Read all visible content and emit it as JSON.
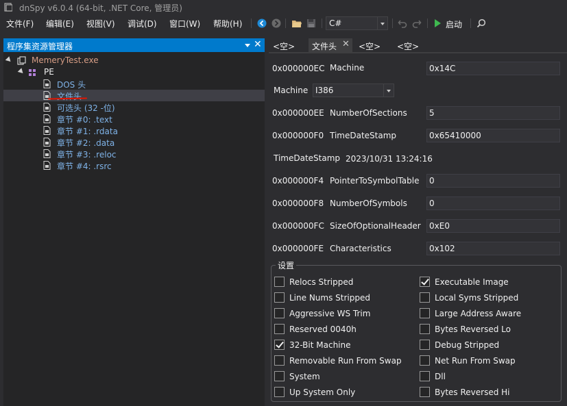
{
  "window": {
    "title": "dnSpy v6.0.4 (64-bit, .NET Core, 管理员)"
  },
  "menu": [
    "文件(F)",
    "编辑(E)",
    "视图(V)",
    "调试(D)",
    "窗口(W)",
    "帮助(H)"
  ],
  "toolbar": {
    "icons": [
      "back-icon",
      "forward-icon",
      "open-file-icon",
      "save-icon",
      "undo-icon",
      "redo-icon",
      "start-icon",
      "search-icon"
    ],
    "language": "C#",
    "start_label": "启动"
  },
  "explorer": {
    "title": "程序集资源管理器",
    "tree": [
      {
        "label": "MemeryTest.exe",
        "level": 0,
        "color": "orange"
      },
      {
        "label": "PE",
        "level": 1,
        "color": "white"
      },
      {
        "label": "DOS 头",
        "level": 2,
        "color": "blue"
      },
      {
        "label": "文件头",
        "level": 2,
        "color": "blue",
        "selected": true
      },
      {
        "label": "可选头 (32 -位)",
        "level": 2,
        "color": "blue"
      },
      {
        "label": "章节 #0: .text",
        "level": 2,
        "color": "blue"
      },
      {
        "label": "章节 #1: .rdata",
        "level": 2,
        "color": "blue"
      },
      {
        "label": "章节 #2: .data",
        "level": 2,
        "color": "blue"
      },
      {
        "label": "章节 #3: .reloc",
        "level": 2,
        "color": "blue"
      },
      {
        "label": "章节 #4: .rsrc",
        "level": 2,
        "color": "blue"
      }
    ]
  },
  "tabs": [
    {
      "label": "<空>"
    },
    {
      "label": "文件头",
      "active": true
    },
    {
      "label": "<空>"
    },
    {
      "label": "<空>"
    }
  ],
  "header": {
    "rows": [
      {
        "offset": "0x000000EC",
        "name": "Machine",
        "value": "0x14C"
      },
      {
        "offset": "0x000000EE",
        "name": "NumberOfSections",
        "value": "5"
      },
      {
        "offset": "0x000000F0",
        "name": "TimeDateStamp",
        "value": "0x65410000"
      },
      {
        "offset": "0x000000F4",
        "name": "PointerToSymbolTable",
        "value": "0"
      },
      {
        "offset": "0x000000F8",
        "name": "NumberOfSymbols",
        "value": "0"
      },
      {
        "offset": "0x000000FC",
        "name": "SizeOfOptionalHeader",
        "value": "0xE0"
      },
      {
        "offset": "0x000000FE",
        "name": "Characteristics",
        "value": "0x102"
      }
    ],
    "machine_label": "Machine",
    "machine_value": "I386",
    "timestamp_label": "TimeDateStamp",
    "timestamp_value": "2023/10/31 13:24:16"
  },
  "settings": {
    "title": "设置",
    "left": [
      {
        "label": "Relocs Stripped",
        "checked": false
      },
      {
        "label": "Line Nums Stripped",
        "checked": false
      },
      {
        "label": "Aggressive WS Trim",
        "checked": false
      },
      {
        "label": "Reserved 0040h",
        "checked": false
      },
      {
        "label": "32-Bit Machine",
        "checked": true
      },
      {
        "label": "Removable Run From Swap",
        "checked": false
      },
      {
        "label": "System",
        "checked": false
      },
      {
        "label": "Up System Only",
        "checked": false
      }
    ],
    "right": [
      {
        "label": "Executable Image",
        "checked": true
      },
      {
        "label": "Local Syms Stripped",
        "checked": false
      },
      {
        "label": "Large Address Aware",
        "checked": false
      },
      {
        "label": "Bytes Reversed Lo",
        "checked": false
      },
      {
        "label": "Debug Stripped",
        "checked": false
      },
      {
        "label": "Net Run From Swap",
        "checked": false
      },
      {
        "label": "Dll",
        "checked": false
      },
      {
        "label": "Bytes Reversed Hi",
        "checked": false
      }
    ]
  }
}
